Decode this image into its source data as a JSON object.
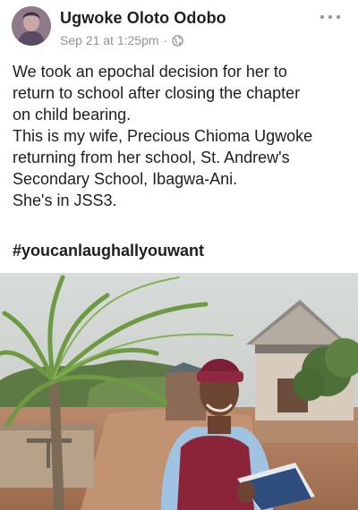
{
  "post": {
    "author_name": "Ugwoke Oloto Odobo",
    "timestamp": "Sep 21 at 1:25pm",
    "separator": "·",
    "privacy_icon": "globe-icon",
    "more_icon": "more-options-icon",
    "body_lines": [
      "We took an epochal decision for her to",
      "return to school after closing the chapter",
      "on child bearing.",
      "This is my wife, Precious Chioma Ugwoke",
      "returning from her school, St. Andrew's",
      "Secondary School, Ibagwa-Ani.",
      "She's in JSS3."
    ],
    "hashtag": "#youcanlaughallyouwant"
  },
  "colors": {
    "text": "#1c1e21",
    "meta": "#8d949e",
    "background": "#ffffff"
  }
}
